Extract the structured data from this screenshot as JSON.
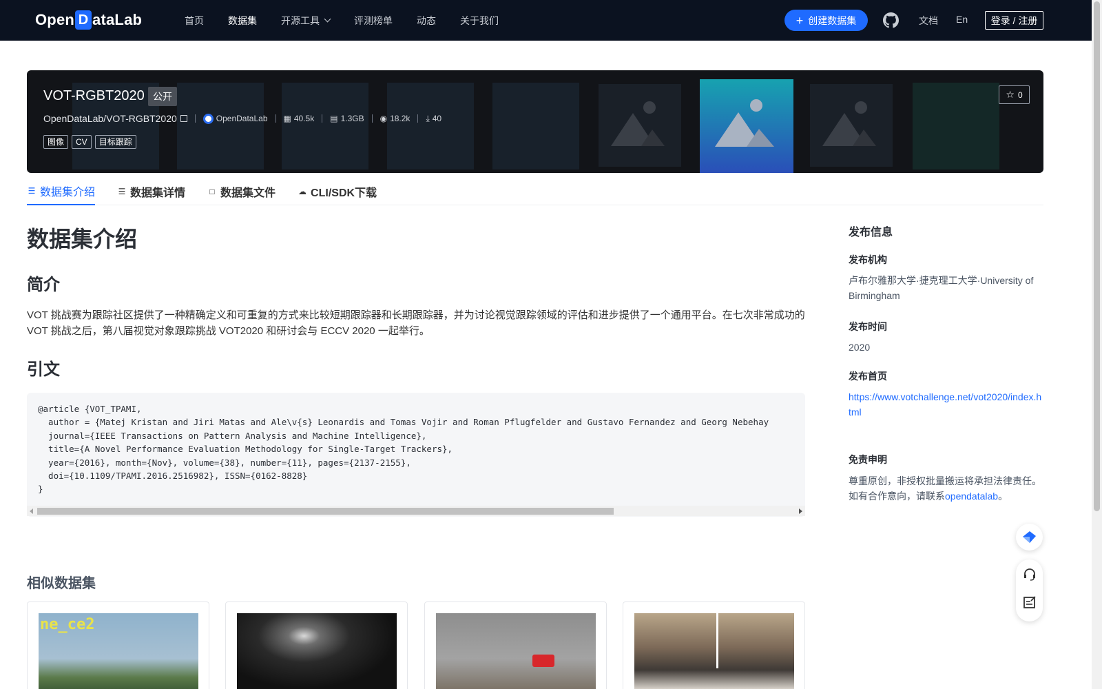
{
  "nav": {
    "logo_pre": "Open",
    "logo_d": "D",
    "logo_post": "ataLab",
    "links": [
      "首页",
      "数据集",
      "开源工具",
      "评测榜单",
      "动态",
      "关于我们"
    ],
    "create_label": "创建数据集",
    "docs_label": "文档",
    "lang_label": "En",
    "login_label": "登录 / 注册"
  },
  "dataset": {
    "title": "VOT-RGBT2020",
    "visibility": "公开",
    "repo": "OpenDataLab/VOT-RGBT2020",
    "publisher_org": "OpenDataLab",
    "data_count": "40.5k",
    "size": "1.3GB",
    "views": "18.2k",
    "downloads": "40",
    "tags": [
      "图像",
      "CV",
      "目标跟踪"
    ],
    "stars": "0"
  },
  "tabs": [
    {
      "label": "数据集介绍",
      "icon": "database-icon"
    },
    {
      "label": "数据集详情",
      "icon": "list-icon"
    },
    {
      "label": "数据集文件",
      "icon": "file-icon"
    },
    {
      "label": "CLI/SDK下载",
      "icon": "cloud-download-icon"
    }
  ],
  "content": {
    "heading": "数据集介绍",
    "intro_heading": "简介",
    "intro_text": "VOT 挑战赛为跟踪社区提供了一种精确定义和可重复的方式来比较短期跟踪器和长期跟踪器，并为讨论视觉跟踪领域的评估和进步提供了一个通用平台。在七次非常成功的 VOT 挑战之后，第八届视觉对象跟踪挑战 VOT2020 和研讨会与 ECCV 2020 一起举行。",
    "citation_heading": "引文",
    "citation_lines": [
      "@article {VOT_TPAMI,",
      "  author = {Matej Kristan and Jiri Matas and Ale\\v{s} Leonardis and Tomas Vojir and Roman Pflugfelder and Gustavo Fernandez and Georg Nebehay",
      "  journal={IEEE Transactions on Pattern Analysis and Machine Intelligence},",
      "  title={A Novel Performance Evaluation Methodology for Single-Target Trackers},",
      "  year={2016}, month={Nov}, volume={38}, number={11}, pages={2137-2155},",
      "  doi={10.1109/TPAMI.2016.2516982}, ISSN={0162-8828}",
      "}"
    ],
    "similar_heading": "相似数据集",
    "similar_card_text": "ne_ce2"
  },
  "sidebar": {
    "title": "发布信息",
    "org_label": "发布机构",
    "org_value": "卢布尔雅那大学·捷克理工大学·University of Birmingham",
    "time_label": "发布时间",
    "time_value": "2020",
    "home_label": "发布首页",
    "home_url": "https://www.votchallenge.net/vot2020/index.html",
    "disclaimer_label": "免责申明",
    "disclaimer_text_1": "尊重原创，非授权批量搬运将承担法律责任。",
    "disclaimer_text_2": "如有合作意向，请联系",
    "disclaimer_link": "opendatalab",
    "disclaimer_end": "。"
  },
  "colors": {
    "nav_bg": "#0b1220",
    "accent": "#1f6bff",
    "banner_bg": "#121418"
  }
}
